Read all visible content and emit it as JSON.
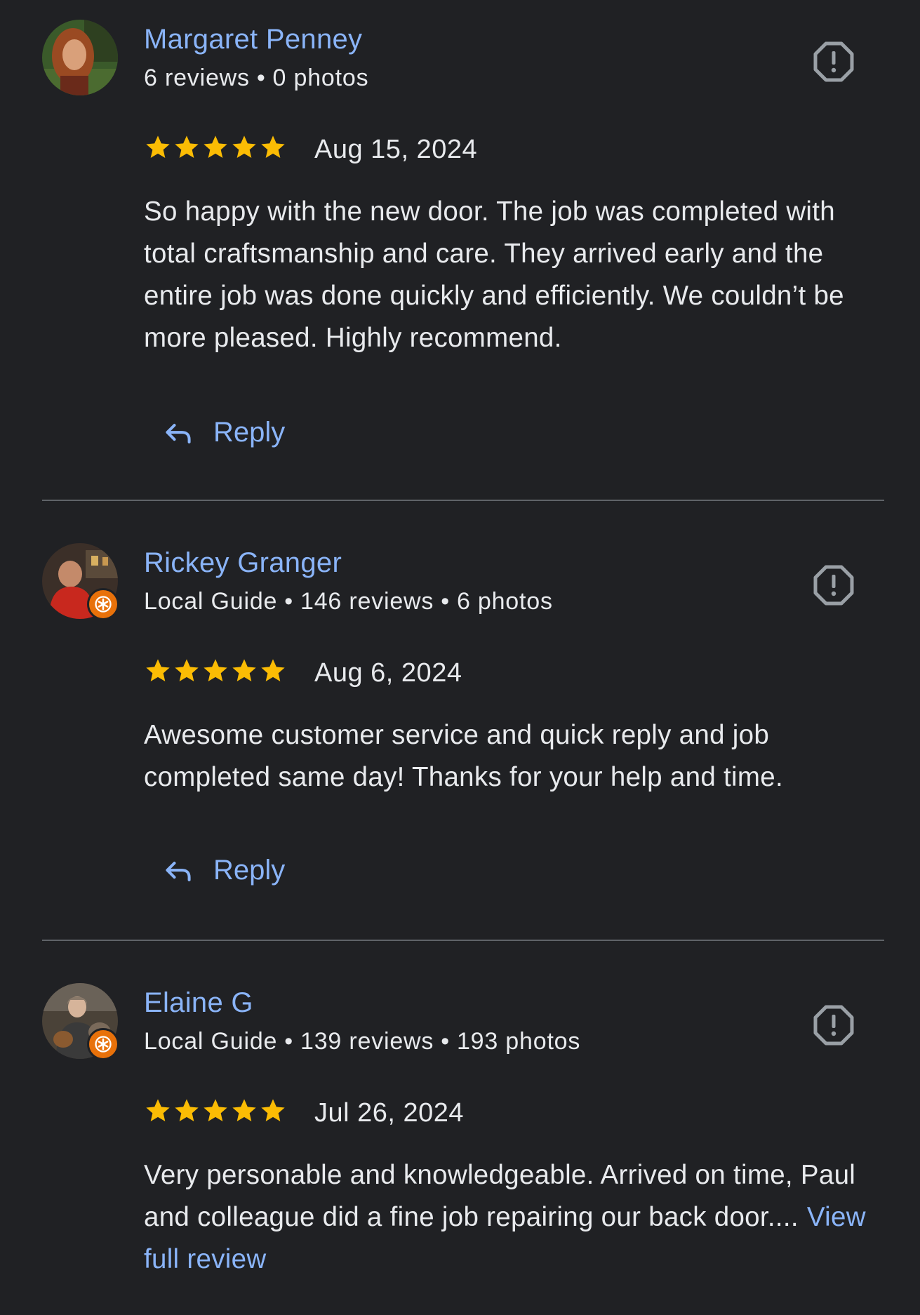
{
  "reviews": [
    {
      "name": "Margaret Penney",
      "meta": [
        "6 reviews",
        "0 photos"
      ],
      "rating": 5,
      "date": "Aug 15, 2024",
      "text": "So happy with the new door. The job was completed with total craftsmanship and care. They arrived early and the entire job was done quickly and efficiently. We couldn’t be more pleased. Highly recommend.",
      "reply_label": "Reply",
      "local_guide": false
    },
    {
      "name": "Rickey Granger",
      "meta": [
        "Local Guide",
        "146 reviews",
        "6 photos"
      ],
      "rating": 5,
      "date": "Aug 6, 2024",
      "text": "Awesome customer service and quick reply and job completed same day! Thanks for your help and time.",
      "reply_label": "Reply",
      "local_guide": true
    },
    {
      "name": "Elaine G",
      "meta": [
        "Local Guide",
        "139 reviews",
        "193 photos"
      ],
      "rating": 5,
      "date": "Jul 26, 2024",
      "text": "Very personable and knowledgeable. Arrived on time, Paul and colleague did a fine job repairing our back door....",
      "more_label": "View full review",
      "local_guide": true
    }
  ],
  "colors": {
    "background": "#202124",
    "link": "#8ab4f8",
    "text": "#e8eaed",
    "star": "#fbbc04",
    "divider": "#5f6368",
    "local_guide_badge": "#e8710a"
  },
  "icons": {
    "flag": "report-flag-icon",
    "reply": "reply-arrow-icon",
    "star": "star-icon",
    "badge": "local-guide-badge-icon"
  }
}
